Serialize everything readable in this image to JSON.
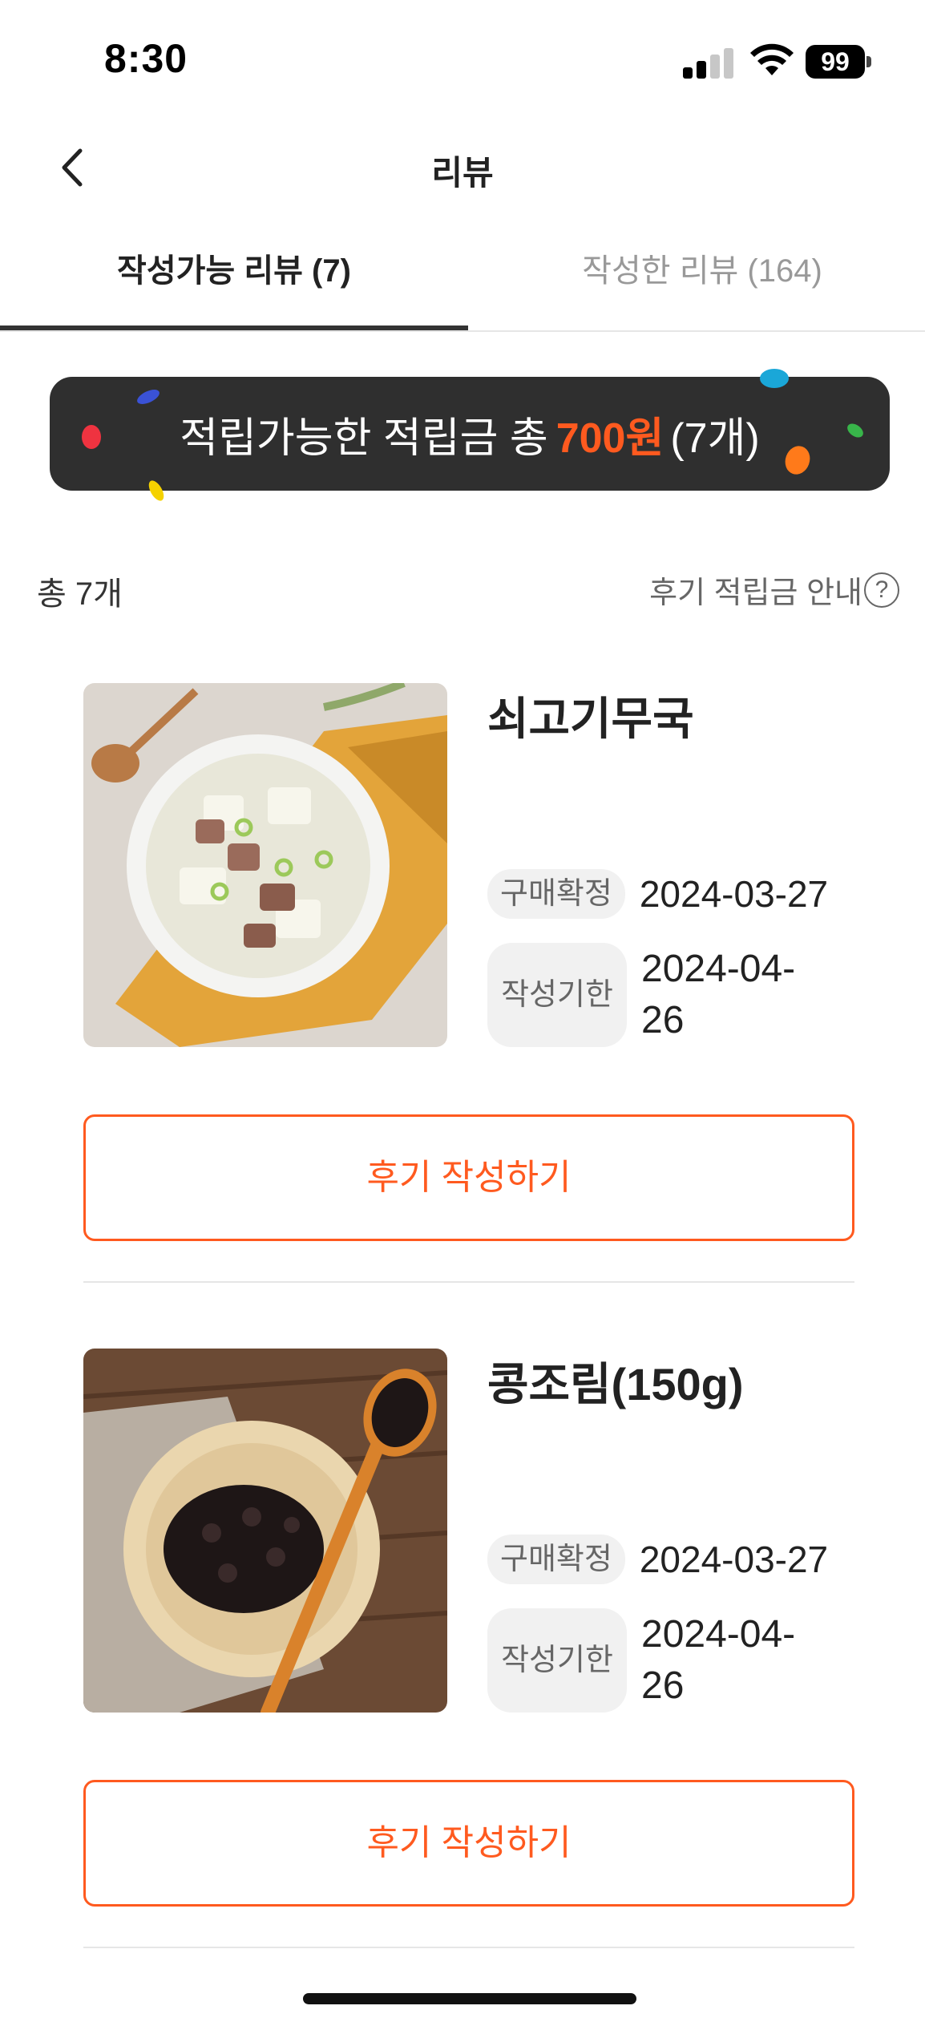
{
  "status_bar": {
    "time": "8:30",
    "battery": "99"
  },
  "header": {
    "title": "리뷰"
  },
  "tabs": [
    {
      "label": "작성가능 리뷰 (7)",
      "active": true
    },
    {
      "label": "작성한 리뷰 (164)",
      "active": false
    }
  ],
  "banner": {
    "prefix": "적립가능한 적립금 총",
    "amount": "700원",
    "suffix": "(7개)"
  },
  "list_header": {
    "total": "총 7개",
    "guide": "후기 적립금 안내",
    "guide_icon": "?"
  },
  "reviews": [
    {
      "name": "쇠고기무국",
      "confirm_label": "구매확정",
      "confirm_date": "2024-03-27",
      "deadline_label": "작성기한",
      "deadline_date": "2024-04-26",
      "button_label": "후기 작성하기"
    },
    {
      "name": "콩조림(150g)",
      "confirm_label": "구매확정",
      "confirm_date": "2024-03-27",
      "deadline_label": "작성기한",
      "deadline_date": "2024-04-26",
      "button_label": "후기 작성하기"
    }
  ],
  "colors": {
    "accent": "#ff5a1f",
    "banner_bg": "#2f2f2f",
    "pill_bg": "#f1f1f1"
  },
  "icons": [
    "back-arrow-icon",
    "help-circle-icon",
    "signal-icon",
    "wifi-icon",
    "battery-icon"
  ]
}
